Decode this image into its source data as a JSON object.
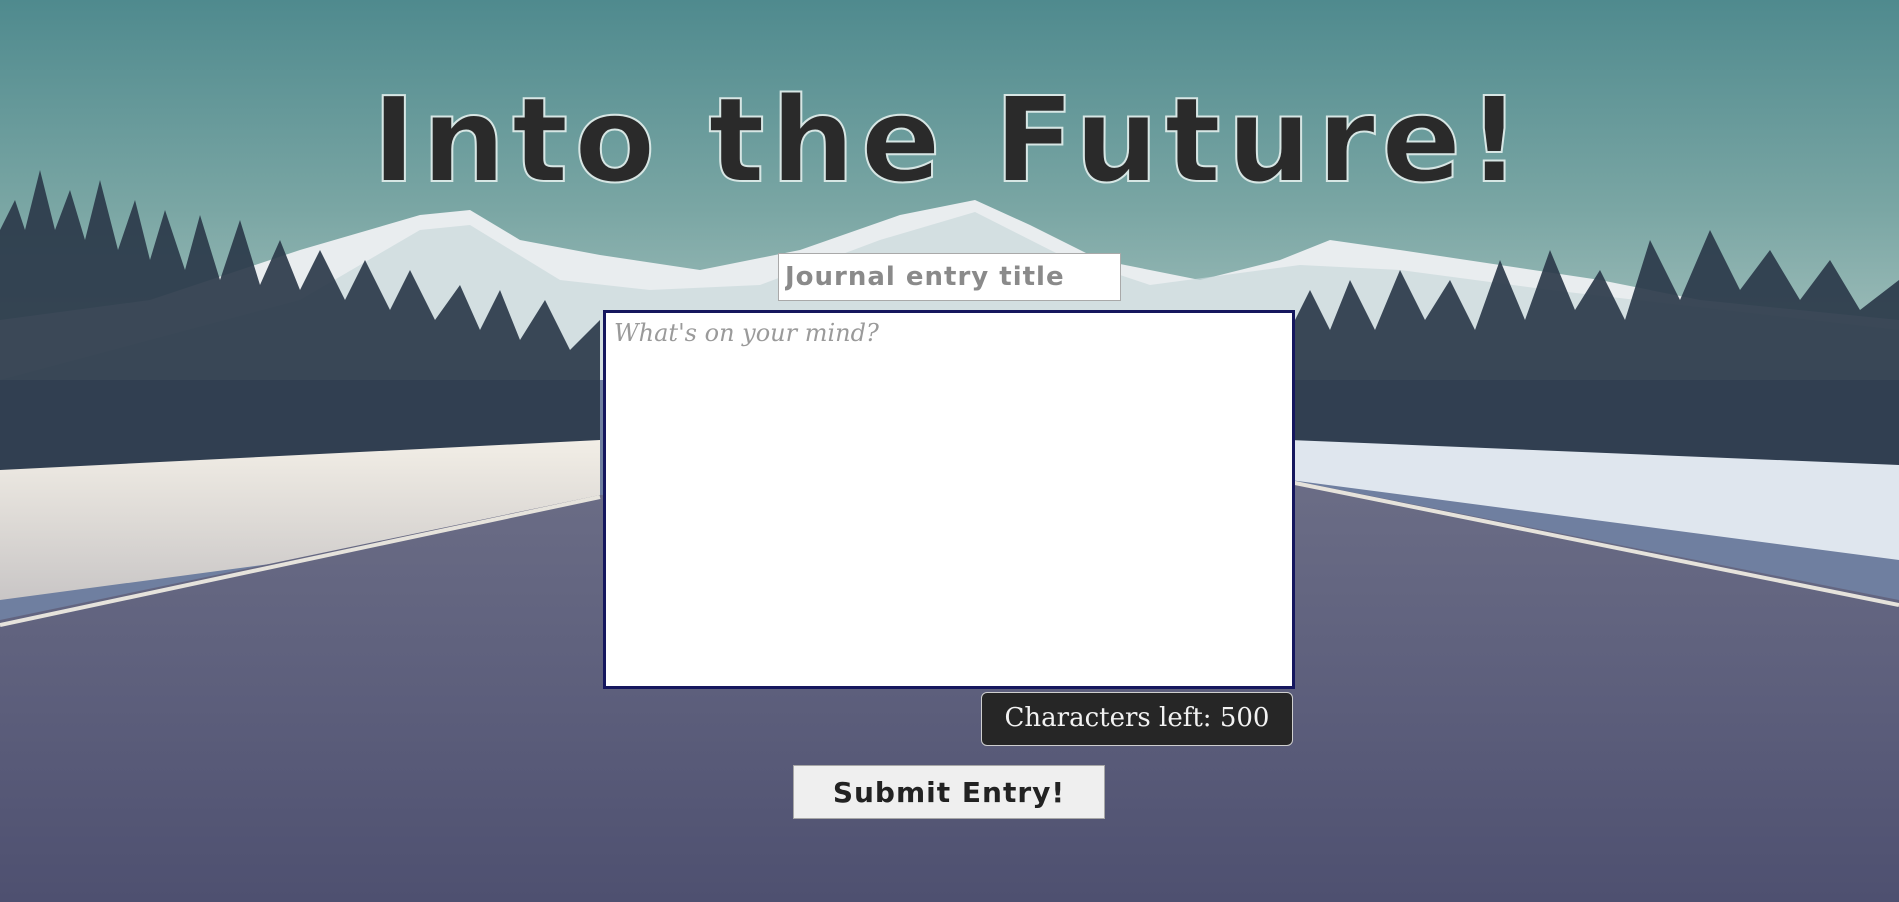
{
  "page": {
    "title": "Into the Future!"
  },
  "form": {
    "title_placeholder": "Journal entry title",
    "title_value": "",
    "entry_placeholder": "What's on your mind?",
    "entry_value": "",
    "counter_text": "Characters left: 500",
    "submit_label": "Submit Entry!"
  },
  "colors": {
    "title_text": "#2a2a2a",
    "textarea_border": "#15175e",
    "counter_bg": "#262626",
    "button_bg": "#efefef"
  },
  "background": {
    "description_icon": "landscape-background"
  }
}
